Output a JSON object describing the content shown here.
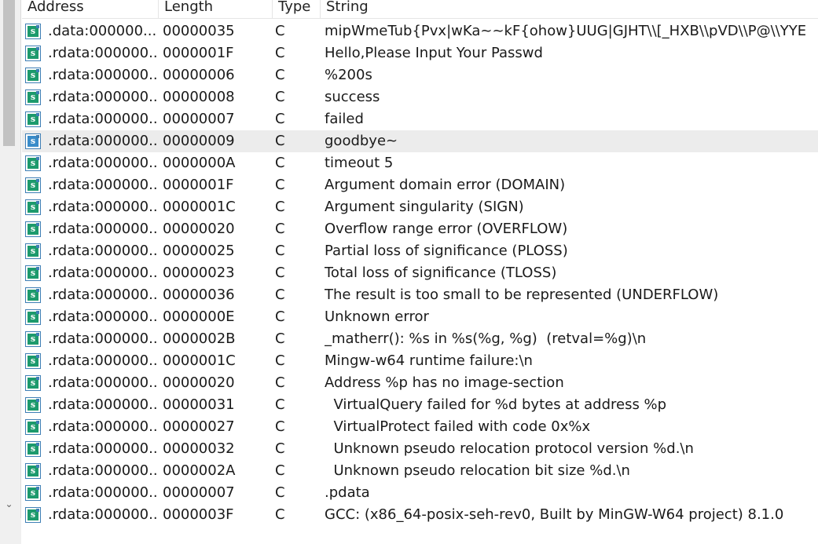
{
  "columns": {
    "address": "Address",
    "length": "Length",
    "type": "Type",
    "string": "String"
  },
  "icon": "string-literal-icon",
  "icon_letter": "s",
  "selected_index": 5,
  "colors": {
    "icon_green": "#1d9a6c",
    "icon_border": "#3f7fb5",
    "selection": "#ececec"
  },
  "rows": [
    {
      "address": ".data:000000...",
      "length": "00000035",
      "type": "C",
      "string": "mipWmeTub{Pvx|wKa~~kF{ohow}UUG|GJHT\\\\[_HXB\\\\pVD\\\\P@\\\\YYE"
    },
    {
      "address": ".rdata:000000...",
      "length": "0000001F",
      "type": "C",
      "string": "Hello,Please Input Your Passwd"
    },
    {
      "address": ".rdata:000000...",
      "length": "00000006",
      "type": "C",
      "string": "%200s"
    },
    {
      "address": ".rdata:000000...",
      "length": "00000008",
      "type": "C",
      "string": "success"
    },
    {
      "address": ".rdata:000000...",
      "length": "00000007",
      "type": "C",
      "string": "failed"
    },
    {
      "address": ".rdata:000000...",
      "length": "00000009",
      "type": "C",
      "string": "goodbye~"
    },
    {
      "address": ".rdata:000000...",
      "length": "0000000A",
      "type": "C",
      "string": "timeout 5"
    },
    {
      "address": ".rdata:000000...",
      "length": "0000001F",
      "type": "C",
      "string": "Argument domain error (DOMAIN)"
    },
    {
      "address": ".rdata:000000...",
      "length": "0000001C",
      "type": "C",
      "string": "Argument singularity (SIGN)"
    },
    {
      "address": ".rdata:000000...",
      "length": "00000020",
      "type": "C",
      "string": "Overflow range error (OVERFLOW)"
    },
    {
      "address": ".rdata:000000...",
      "length": "00000025",
      "type": "C",
      "string": "Partial loss of significance (PLOSS)"
    },
    {
      "address": ".rdata:000000...",
      "length": "00000023",
      "type": "C",
      "string": "Total loss of significance (TLOSS)"
    },
    {
      "address": ".rdata:000000...",
      "length": "00000036",
      "type": "C",
      "string": "The result is too small to be represented (UNDERFLOW)"
    },
    {
      "address": ".rdata:000000...",
      "length": "0000000E",
      "type": "C",
      "string": "Unknown error"
    },
    {
      "address": ".rdata:000000...",
      "length": "0000002B",
      "type": "C",
      "string": "_matherr(): %s in %s(%g, %g)  (retval=%g)\\n"
    },
    {
      "address": ".rdata:000000...",
      "length": "0000001C",
      "type": "C",
      "string": "Mingw-w64 runtime failure:\\n"
    },
    {
      "address": ".rdata:000000...",
      "length": "00000020",
      "type": "C",
      "string": "Address %p has no image-section"
    },
    {
      "address": ".rdata:000000...",
      "length": "00000031",
      "type": "C",
      "string": "  VirtualQuery failed for %d bytes at address %p"
    },
    {
      "address": ".rdata:000000...",
      "length": "00000027",
      "type": "C",
      "string": "  VirtualProtect failed with code 0x%x"
    },
    {
      "address": ".rdata:000000...",
      "length": "00000032",
      "type": "C",
      "string": "  Unknown pseudo relocation protocol version %d.\\n"
    },
    {
      "address": ".rdata:000000...",
      "length": "0000002A",
      "type": "C",
      "string": "  Unknown pseudo relocation bit size %d.\\n"
    },
    {
      "address": ".rdata:000000...",
      "length": "00000007",
      "type": "C",
      "string": ".pdata"
    },
    {
      "address": ".rdata:000000...",
      "length": "0000003F",
      "type": "C",
      "string": "GCC: (x86_64-posix-seh-rev0, Built by MinGW-W64 project) 8.1.0"
    }
  ]
}
